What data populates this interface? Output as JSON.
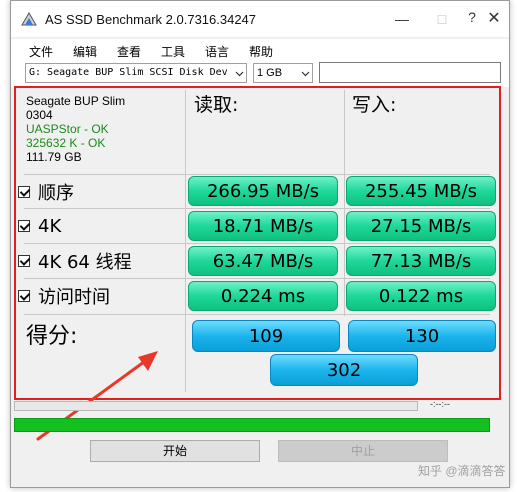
{
  "window": {
    "title": "AS SSD Benchmark 2.0.7316.34247",
    "controls": {
      "min": "—",
      "max": "□",
      "help": "?",
      "close": "✕"
    }
  },
  "menu": [
    "文件",
    "编辑",
    "查看",
    "工具",
    "语言",
    "帮助"
  ],
  "toolbar": {
    "drive_selected": "G: Seagate BUP Slim SCSI Disk Dev",
    "size_selected": "1 GB",
    "search_value": ""
  },
  "drive_info": {
    "name": "Seagate BUP Slim",
    "firmware": "0304",
    "driver": "UASPStor - OK",
    "alignment": "325632 K - OK",
    "capacity": "111.79 GB"
  },
  "columns": {
    "read": "读取:",
    "write": "写入:"
  },
  "rows": [
    {
      "label": "顺序",
      "read": "266.95 MB/s",
      "write": "255.45 MB/s"
    },
    {
      "label": "4K",
      "read": "18.71 MB/s",
      "write": "27.15 MB/s"
    },
    {
      "label": "4K 64 线程",
      "read": "63.47 MB/s",
      "write": "77.13 MB/s"
    },
    {
      "label": "访问时间",
      "read": "0.224 ms",
      "write": "0.122 ms"
    }
  ],
  "score": {
    "label": "得分:",
    "read": "109",
    "write": "130",
    "total": "302"
  },
  "status_text": "-:--:--",
  "buttons": {
    "start": "开始",
    "stop": "中止"
  },
  "watermark": "知乎 @滴滴答答",
  "colors": {
    "result_green": "#1ed89a",
    "score_blue": "#1cb4ec",
    "progress_green": "#12c020",
    "highlight_red": "#e02020"
  }
}
